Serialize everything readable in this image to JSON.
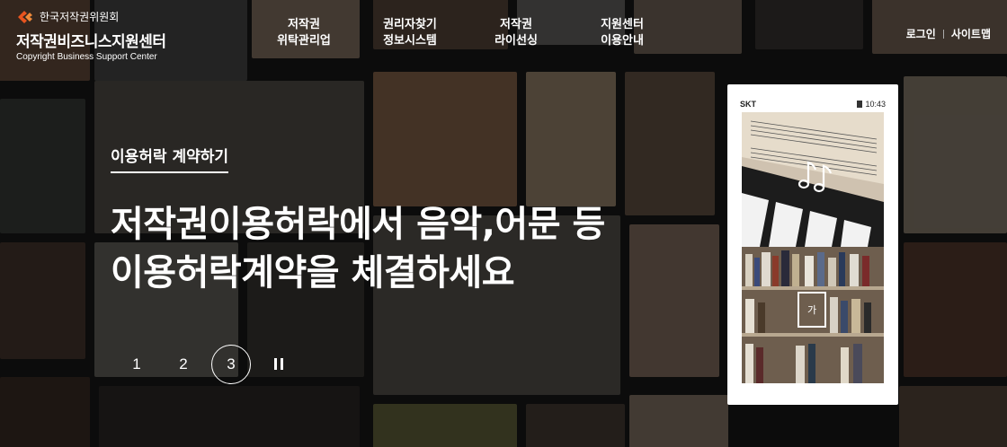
{
  "brand": {
    "org": "한국저작권위원회",
    "title": "저작권비즈니스지원센터",
    "subtitle": "Copyright Business Support Center"
  },
  "nav": [
    {
      "line1": "저작권",
      "line2": "위탁관리업"
    },
    {
      "line1": "권리자찾기",
      "line2": "정보시스템"
    },
    {
      "line1": "저작권",
      "line2": "라이선싱"
    },
    {
      "line1": "지원센터",
      "line2": "이용안내"
    }
  ],
  "util": {
    "login": "로그인",
    "sitemap": "사이트맵"
  },
  "hero": {
    "eyebrow": "이용허락 계약하기",
    "line1": "저작권이용허락에서 음악,어문 등",
    "line2": "이용허락계약을 체결하세요"
  },
  "pager": {
    "pages": [
      "1",
      "2",
      "3"
    ],
    "active": "3"
  },
  "phone": {
    "carrier": "SKT",
    "time": "10:43",
    "book_label": "가"
  },
  "colors": {
    "logo_accent": "#e8541f",
    "text": "#ffffff",
    "overlay": "#000000"
  },
  "icons": {
    "music": "music-notes-icon",
    "pause": "pause-icon"
  }
}
